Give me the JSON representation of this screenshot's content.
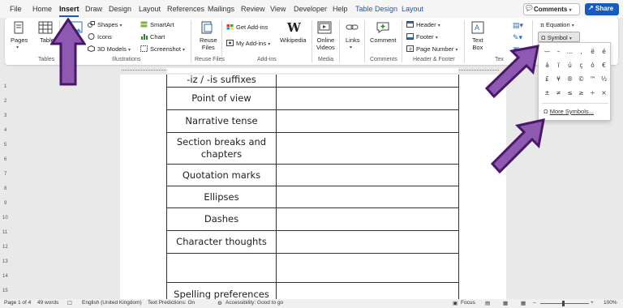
{
  "menu": {
    "tabs": [
      "File",
      "Home",
      "Insert",
      "Draw",
      "Design",
      "Layout",
      "References",
      "Mailings",
      "Review",
      "View",
      "Developer",
      "Help",
      "Table Design",
      "Layout"
    ],
    "active_tab": "Insert",
    "comments_label": "Comments",
    "share_label": "Share"
  },
  "ribbon": {
    "pages": "Pages",
    "table": "Table",
    "tables_group": "Tables",
    "shapes": "Shapes",
    "icons": "Icons",
    "models_3d": "3D Models",
    "smartart": "SmartArt",
    "chart": "Chart",
    "screenshot": "Screenshot",
    "illustrations_group": "Illustrations",
    "reuse_files": "Reuse\nFiles",
    "reuse_files_group": "Reuse Files",
    "get_addins": "Get Add-ins",
    "my_addins": "My Add-ins",
    "wikipedia": "Wikipedia",
    "addins_group": "Add-ins",
    "online_videos": "Online\nVideos",
    "media_group": "Media",
    "links": "Links",
    "comment": "Comment",
    "comments_group": "Comments",
    "header": "Header",
    "footer": "Footer",
    "page_number": "Page Number",
    "header_footer_group": "Header & Footer",
    "text_box": "Text\nBox",
    "text_group": "Tex",
    "equation": "Equation",
    "symbol": "Symbol"
  },
  "symbol_panel": {
    "symbols": [
      "—",
      "–",
      "…",
      "‚",
      "ë",
      "é",
      "á",
      "ï",
      "ú",
      "ç",
      "ó",
      "€",
      "£",
      "¥",
      "®",
      "©",
      "™",
      "½",
      "±",
      "≠",
      "≤",
      "≥",
      "÷",
      "×"
    ],
    "more_symbols": "More Symbols..."
  },
  "document": {
    "rows": [
      "-iz / -is suffixes",
      "Point of view",
      "Narrative tense",
      "Section breaks and chapters",
      "Quotation marks",
      "Ellipses",
      "Dashes",
      "Character thoughts",
      "",
      "Spelling preferences"
    ]
  },
  "ruler_numbers": [
    "1",
    "2",
    "3",
    "4",
    "5",
    "6",
    "7",
    "8",
    "9",
    "10",
    "11",
    "12",
    "13",
    "14",
    "15"
  ],
  "status": {
    "page": "Page 1 of 4",
    "words": "49 words",
    "language": "English (United Kingdom)",
    "predictions": "Text Predictions: On",
    "accessibility": "Accessibility: Good to go",
    "focus": "Focus",
    "zoom": "100%"
  },
  "colors": {
    "accent": "#185abd",
    "arrow_fill": "#8e59b0",
    "arrow_stroke": "#4b1868"
  }
}
